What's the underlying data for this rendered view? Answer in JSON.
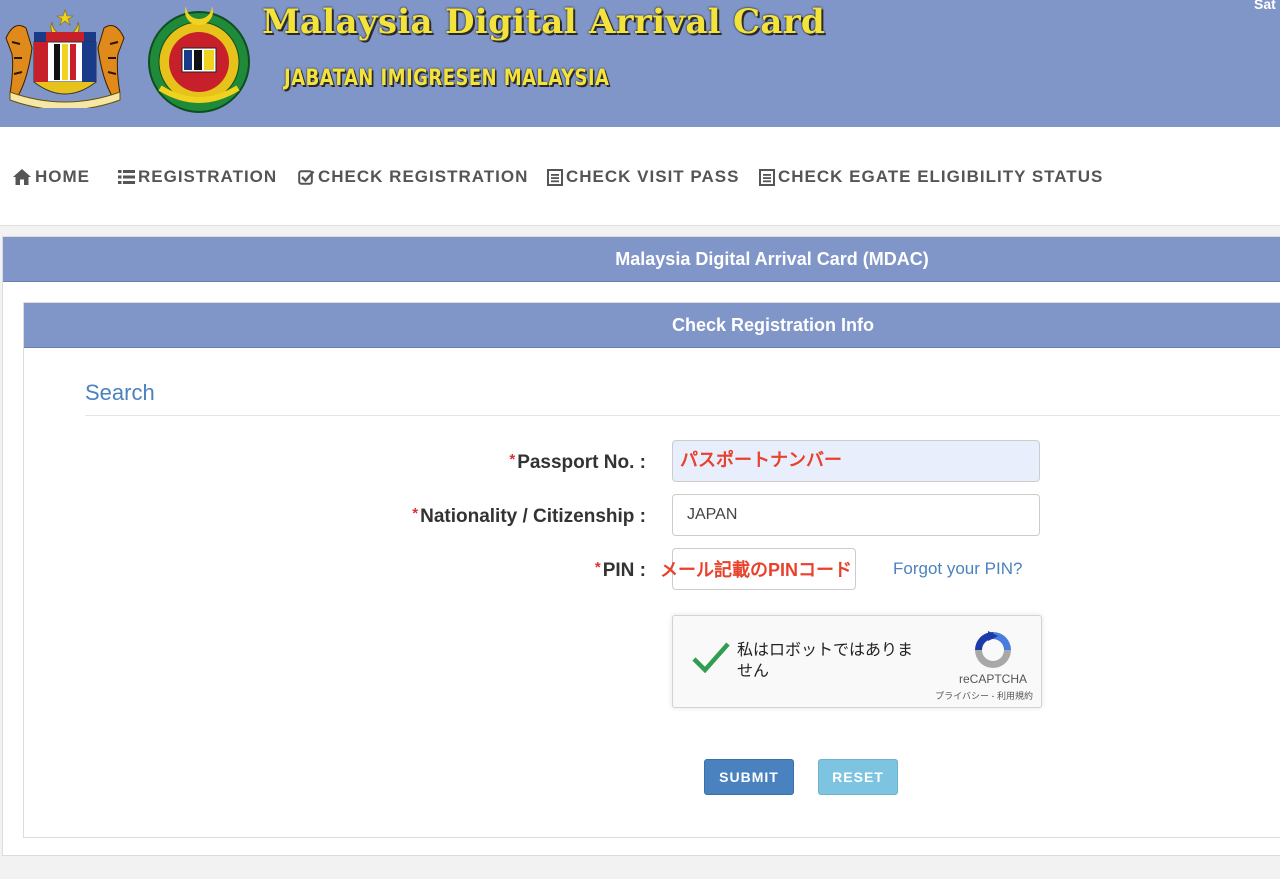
{
  "banner": {
    "title": "Malaysia Digital Arrival Card",
    "subtitle": "JABATAN IMIGRESEN MALAYSIA",
    "date_fragment": "Sat",
    "crest_motto": "BERSEKUTU BERTAMBAH MUTU",
    "emblem_text": "IMIGRESEN MALAYSIA"
  },
  "nav": {
    "items": [
      {
        "label": "HOME",
        "icon": "home-icon"
      },
      {
        "label": "REGISTRATION",
        "icon": "list-icon"
      },
      {
        "label": "CHECK REGISTRATION",
        "icon": "check-square-icon"
      },
      {
        "label": "CHECK VISIT PASS",
        "icon": "document-icon"
      },
      {
        "label": "CHECK EGATE ELIGIBILITY STATUS",
        "icon": "document-icon"
      }
    ]
  },
  "panel": {
    "title": "Malaysia Digital Arrival Card (MDAC)",
    "subpanel_title": "Check Registration Info",
    "section_title": "Search"
  },
  "form": {
    "required_mark": "*",
    "passport_label": "Passport No. :",
    "passport_annotation": "パスポートナンバー",
    "nationality_label": "Nationality / Citizenship :",
    "nationality_value": "JAPAN",
    "pin_label": "PIN :",
    "pin_annotation": "メール記載のPINコード",
    "forgot_pin": "Forgot your PIN?"
  },
  "recaptcha": {
    "text": "私はロボットではありません",
    "brand": "reCAPTCHA",
    "links": "プライバシー - 利用規約"
  },
  "buttons": {
    "submit": "SUBMIT",
    "reset": "RESET"
  },
  "colors": {
    "header_blue": "#8095c8",
    "link_blue": "#4a82c0",
    "title_yellow": "#f3e33b",
    "annotation_red": "#e8412c",
    "reset_cyan": "#7cc4df"
  }
}
